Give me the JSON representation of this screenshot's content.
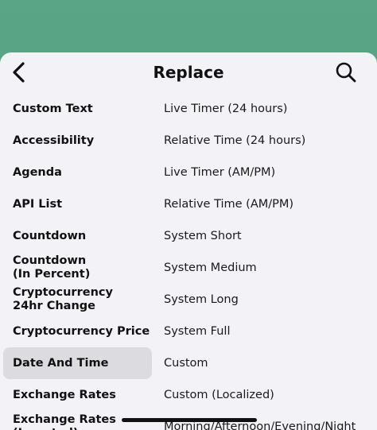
{
  "header": {
    "title": "Replace"
  },
  "categories": [
    {
      "label": "Custom Text"
    },
    {
      "label": "Accessibility"
    },
    {
      "label": "Agenda"
    },
    {
      "label": "API List"
    },
    {
      "label": "Countdown"
    },
    {
      "label": "Countdown\n(In Percent)"
    },
    {
      "label": "Cryptocurrency\n24hr Change"
    },
    {
      "label": "Cryptocurrency Price"
    },
    {
      "label": "Date And Time",
      "selected": true
    },
    {
      "label": "Exchange Rates"
    },
    {
      "label": "Exchange Rates\n(Inverted)"
    }
  ],
  "options": [
    {
      "label": "Live Timer (24 hours)"
    },
    {
      "label": "Relative Time (24 hours)"
    },
    {
      "label": "Live Timer (AM/PM)"
    },
    {
      "label": "Relative Time (AM/PM)"
    },
    {
      "label": "System Short"
    },
    {
      "label": "System Medium"
    },
    {
      "label": "System Long"
    },
    {
      "label": "System Full"
    },
    {
      "label": "Custom"
    },
    {
      "label": "Custom (Localized)"
    },
    {
      "label": "Morning/Afternoon/Evening/Night"
    }
  ],
  "icons": {
    "back": "chevron-left-icon",
    "search": "search-icon"
  }
}
